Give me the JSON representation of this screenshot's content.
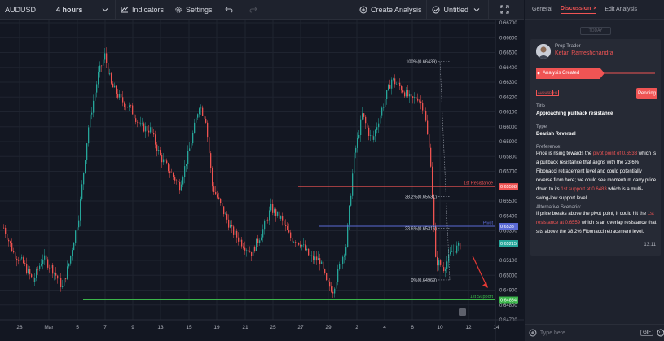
{
  "toolbar": {
    "symbol": "AUDUSD",
    "interval": "4 hours",
    "indicators": "Indicators",
    "settings": "Settings",
    "create_analysis": "Create Analysis",
    "layout_name": "Untitled"
  },
  "chart": {
    "price_ticks": [
      "0.66700",
      "0.66600",
      "0.66500",
      "0.66400",
      "0.66300",
      "0.66200",
      "0.66100",
      "0.66000",
      "0.65900",
      "0.65800",
      "0.65700",
      "0.65600",
      "0.65500",
      "0.65400",
      "0.65300",
      "0.65200",
      "0.65100",
      "0.65000",
      "0.64900",
      "0.64800",
      "0.64700"
    ],
    "date_ticks": [
      "28",
      "Mar",
      "5",
      "7",
      "9",
      "13",
      "15",
      "19",
      "21",
      "25",
      "27",
      "29",
      "2",
      "4",
      "6",
      "10",
      "12",
      "14"
    ],
    "fib_levels": [
      {
        "label": "100%(0.66439)",
        "price": 0.66439
      },
      {
        "label": "38.2%(0.65531)",
        "price": 0.65531
      },
      {
        "label": "23.6%(0.65316)",
        "price": 0.65316
      },
      {
        "label": "0%(0.64969)",
        "price": 0.64969
      }
    ],
    "levels": [
      {
        "name": "1st Resistance",
        "price": 0.65598,
        "tag": "0.65598",
        "color": "#f05454"
      },
      {
        "name": "Pivot",
        "price": 0.6533,
        "tag": "0.6533",
        "color": "#5b6bd6"
      },
      {
        "name": "1st Support",
        "price": 0.64834,
        "tag": "0.64834",
        "color": "#3bb54a"
      }
    ],
    "last_price_tag": "0.65215",
    "bullish_color": "#26a69a",
    "bearish_color": "#ef5350"
  },
  "panel": {
    "tabs": [
      "General",
      "Discussion",
      "Edit Analysis"
    ],
    "tab_close": "×",
    "today": "TODAY",
    "role": "Prop Trader",
    "author": "Ketan Rameshchandra",
    "banner": "Analysis Created",
    "badges": [
      "AUDUSD",
      "H4"
    ],
    "status": "Pending",
    "title_label": "Title",
    "title_value": "Approaching pullback resistance",
    "type_label": "Type",
    "type_value": "Bearish Reversal",
    "pref_label": "Preference:",
    "pref": {
      "t1": "Price is rising towards the ",
      "h1": "pivot point of 0.6533",
      "t2": " which is a pullback resistance that aligns with the 23.6% Fibonacci retracement level and could potentially reverse from here; we could see momentum carry price down to its ",
      "h2": "1st support at 0.6483",
      "t3": " which is a multi-swing-low support level."
    },
    "alt_label": "Alternative Scenario:",
    "alt": {
      "t1": "If price breaks above the pivot point, it could hit the ",
      "h1": "1st resistance at 0.6559",
      "t2": " which is an overlap resistance that sits above the 38.2% Fibonacci retracement level."
    },
    "time": "13:11",
    "composer_placeholder": "Type here...",
    "gif": "GIF"
  }
}
